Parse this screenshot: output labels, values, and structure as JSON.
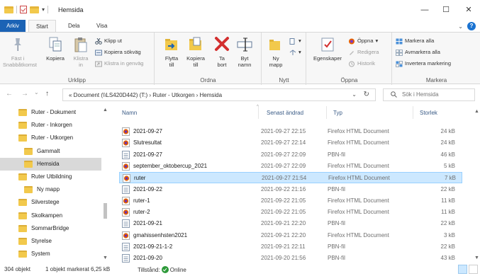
{
  "window": {
    "title": "Hemsida",
    "minimize_icon": "minimize-icon",
    "maximize_icon": "maximize-icon",
    "close_icon": "close-icon",
    "min_glyph": "—",
    "max_glyph": "☐",
    "close_glyph": "✕"
  },
  "ribbon_tabs": {
    "file": "Arkiv",
    "start": "Start",
    "share": "Dela",
    "view": "Visa"
  },
  "ribbon": {
    "clipboard": {
      "label": "Urklipp",
      "pin": "Fäst i\nSnabbåtkomst",
      "pin_line1": "Fäst i",
      "pin_line2": "Snabbåtkomst",
      "copy": "Kopiera",
      "paste_line1": "Klistra",
      "paste_line2": "in",
      "cut": "Klipp ut",
      "copy_path": "Kopiera sökväg",
      "paste_shortcut": "Klistra in genväg"
    },
    "organize": {
      "label": "Ordna",
      "move_line1": "Flytta",
      "move_line2": "till",
      "copyto_line1": "Kopiera",
      "copyto_line2": "till",
      "delete_line1": "Ta",
      "delete_line2": "bort",
      "rename_line1": "Byt",
      "rename_line2": "namn"
    },
    "new": {
      "label": "Nytt",
      "newfolder_line1": "Ny",
      "newfolder_line2": "mapp"
    },
    "open": {
      "label": "Öppna",
      "properties": "Egenskaper",
      "open": "Öppna",
      "edit": "Redigera",
      "history": "Historik"
    },
    "select": {
      "label": "Markera",
      "select_all": "Markera alla",
      "select_none": "Avmarkera alla",
      "invert": "Invertera markering"
    }
  },
  "addressbar": {
    "path": "«  Document (\\\\LS420D442) (T:)  ›  Ruter - Utkorgen  ›  Hemsida",
    "search_placeholder": "Sök i Hemsida",
    "back": "←",
    "forward": "→",
    "recent": "⌄",
    "up": "↑",
    "dropdown": "⌄",
    "refresh": "↻"
  },
  "navpane": {
    "items": [
      {
        "label": "Ruter - Dokument",
        "indent": 0
      },
      {
        "label": "Ruter - Inkorgen",
        "indent": 0
      },
      {
        "label": "Ruter - Utkorgen",
        "indent": 0
      },
      {
        "label": "Gammalt",
        "indent": 1
      },
      {
        "label": "Hemsida",
        "indent": 1,
        "selected": true
      },
      {
        "label": "Ruter Utbildning",
        "indent": 0
      },
      {
        "label": "Ny mapp",
        "indent": 1
      },
      {
        "label": "Silverstege",
        "indent": 0
      },
      {
        "label": "Skolkampen",
        "indent": 0
      },
      {
        "label": "SommarBridge",
        "indent": 0
      },
      {
        "label": "Styrelse",
        "indent": 0
      },
      {
        "label": "System",
        "indent": 0
      }
    ]
  },
  "filelist": {
    "columns": {
      "name": "Namn",
      "date": "Senast ändrad",
      "type": "Typ",
      "size": "Storlek"
    },
    "sort_glyph": "^",
    "rows": [
      {
        "name": "2021-09-27",
        "date": "2021-09-27 22:15",
        "type": "Firefox HTML Document",
        "size": "24 kB",
        "icon": "firefox-html-icon"
      },
      {
        "name": "Slutresultat",
        "date": "2021-09-27 22:14",
        "type": "Firefox HTML Document",
        "size": "24 kB",
        "icon": "firefox-html-icon"
      },
      {
        "name": "2021-09-27",
        "date": "2021-09-27 22:09",
        "type": "PBN-fil",
        "size": "46 kB",
        "icon": "pbn-file-icon"
      },
      {
        "name": "september_oktobercup_2021",
        "date": "2021-09-27 22:09",
        "type": "Firefox HTML Document",
        "size": "5 kB",
        "icon": "firefox-html-icon"
      },
      {
        "name": "ruter",
        "date": "2021-09-27 21:54",
        "type": "Firefox HTML Document",
        "size": "7 kB",
        "icon": "firefox-html-icon",
        "selected": true
      },
      {
        "name": "2021-09-22",
        "date": "2021-09-22 21:16",
        "type": "PBN-fil",
        "size": "22 kB",
        "icon": "pbn-file-icon"
      },
      {
        "name": "ruter-1",
        "date": "2021-09-22 21:05",
        "type": "Firefox HTML Document",
        "size": "11 kB",
        "icon": "firefox-html-icon"
      },
      {
        "name": "ruter-2",
        "date": "2021-09-22 21:05",
        "type": "Firefox HTML Document",
        "size": "11 kB",
        "icon": "firefox-html-icon"
      },
      {
        "name": "2021-09-21",
        "date": "2021-09-21 22:20",
        "type": "PBN-fil",
        "size": "22 kB",
        "icon": "pbn-file-icon"
      },
      {
        "name": "gmahissenhsten2021",
        "date": "2021-09-21 22:20",
        "type": "Firefox HTML Document",
        "size": "3 kB",
        "icon": "firefox-html-icon"
      },
      {
        "name": "2021-09-21-1-2",
        "date": "2021-09-21 22:11",
        "type": "PBN-fil",
        "size": "22 kB",
        "icon": "pbn-file-icon"
      },
      {
        "name": "2021-09-20",
        "date": "2021-09-20 21:56",
        "type": "PBN-fil",
        "size": "43 kB",
        "icon": "pbn-file-icon"
      }
    ]
  },
  "statusbar": {
    "count": "304 objekt",
    "selection": "1 objekt markerat  6,25 kB",
    "state_label": "Tillstånd:",
    "state_value": "Online"
  },
  "colors": {
    "accent": "#1b63b5",
    "selected_row": "#cce8ff",
    "folder": "#f2c94c",
    "online": "#2e9a3a"
  }
}
